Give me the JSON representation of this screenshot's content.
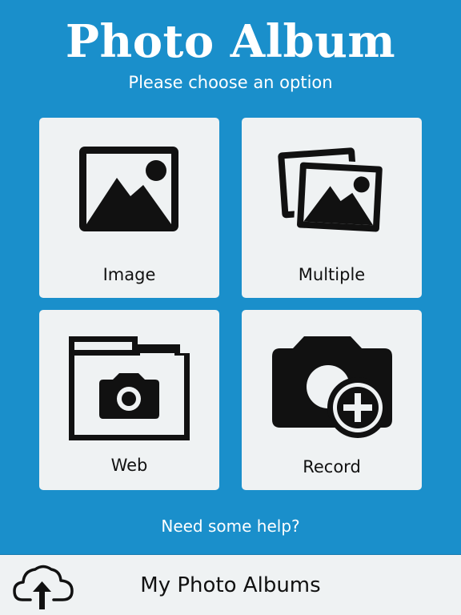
{
  "header": {
    "title": "Photo Album",
    "subtitle": "Please choose an option"
  },
  "tiles": [
    {
      "label": "Image",
      "icon": "image-icon"
    },
    {
      "label": "Multiple",
      "icon": "multiple-images-icon"
    },
    {
      "label": "Web",
      "icon": "folder-camera-icon"
    },
    {
      "label": "Record",
      "icon": "camera-add-icon"
    }
  ],
  "help": {
    "label": "Need some help?"
  },
  "bottom_bar": {
    "label": "My Photo Albums",
    "icon": "cloud-upload-icon"
  },
  "colors": {
    "background": "#1a8fcb",
    "tile": "#eff2f3",
    "text_light": "#ffffff",
    "text_dark": "#111111"
  }
}
